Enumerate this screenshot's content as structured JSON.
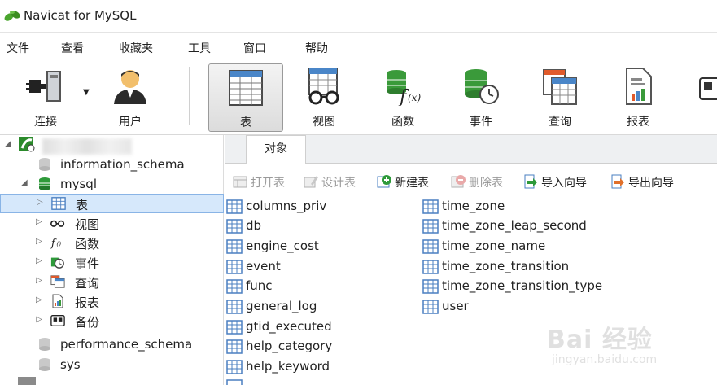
{
  "window": {
    "title": "Navicat for MySQL"
  },
  "menu": [
    "文件",
    "查看",
    "收藏夹",
    "工具",
    "窗口",
    "帮助"
  ],
  "toolbar": [
    {
      "label": "连接",
      "icon": "connect-plug-icon"
    },
    {
      "label": "用户",
      "icon": "user-icon"
    },
    {
      "label": "表",
      "icon": "table-icon",
      "active": true
    },
    {
      "label": "视图",
      "icon": "view-glasses-icon"
    },
    {
      "label": "函数",
      "icon": "function-icon"
    },
    {
      "label": "事件",
      "icon": "event-clock-icon"
    },
    {
      "label": "查询",
      "icon": "query-icon"
    },
    {
      "label": "报表",
      "icon": "report-icon"
    }
  ],
  "nav": {
    "databases": {
      "information_schema": "information_schema",
      "mysql": "mysql",
      "performance_schema": "performance_schema",
      "sys": "sys"
    },
    "mysql_children": [
      "表",
      "视图",
      "函数",
      "事件",
      "查询",
      "报表",
      "备份"
    ]
  },
  "tabs": {
    "objects": "对象"
  },
  "object_toolbar": {
    "open_table": "打开表",
    "design_table": "设计表",
    "new_table": "新建表",
    "delete_table": "删除表",
    "import_wizard": "导入向导",
    "export_wizard": "导出向导"
  },
  "tables_col1": [
    "columns_priv",
    "db",
    "engine_cost",
    "event",
    "func",
    "general_log",
    "gtid_executed",
    "help_category",
    "help_keyword"
  ],
  "tables_col2": [
    "time_zone",
    "time_zone_leap_second",
    "time_zone_name",
    "time_zone_transition",
    "time_zone_transition_type",
    "user"
  ],
  "watermark": {
    "logo": "Bai 经验",
    "url": "jingyan.baidu.com"
  },
  "colors": {
    "selection": "#d6e8fb",
    "selection_border": "#89b4e6",
    "db_icon": "#2e9a3a",
    "table_icon": "#4a7fc1"
  }
}
